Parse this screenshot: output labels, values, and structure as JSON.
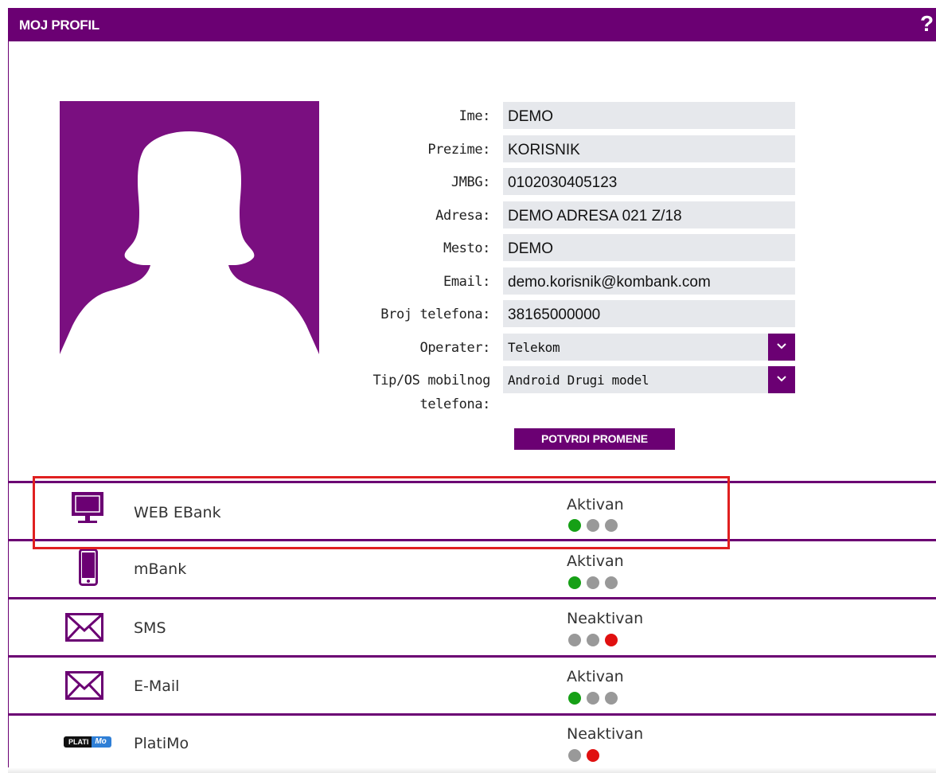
{
  "header": {
    "title": "MOJ PROFIL",
    "help": "?"
  },
  "profile": {
    "fields": [
      {
        "label": "Ime:",
        "value": "DEMO"
      },
      {
        "label": "Prezime:",
        "value": "KORISNIK"
      },
      {
        "label": "JMBG:",
        "value": "0102030405123"
      },
      {
        "label": "Adresa:",
        "value": "DEMO ADRESA 021 Z/18"
      },
      {
        "label": "Mesto:",
        "value": "DEMO"
      },
      {
        "label": "Email:",
        "value": "demo.korisnik@kombank.com"
      },
      {
        "label": "Broj telefona:",
        "value": "38165000000"
      }
    ],
    "operater": {
      "label": "Operater:",
      "value": "Telekom"
    },
    "tip_os": {
      "label_line1": "Tip/OS mobilnog",
      "label_line2": "telefona:",
      "value": "Android Drugi model"
    },
    "confirm_label": "POTVRDI PROMENE"
  },
  "services": [
    {
      "name": "WEB EBank",
      "status": "Aktivan",
      "icon": "monitor-icon",
      "dots": [
        "green",
        "grey",
        "grey"
      ]
    },
    {
      "name": "mBank",
      "status": "Aktivan",
      "icon": "mobile-phone-icon",
      "dots": [
        "green",
        "grey",
        "grey"
      ]
    },
    {
      "name": "SMS",
      "status": "Neaktivan",
      "icon": "envelope-icon",
      "dots": [
        "grey",
        "grey",
        "red"
      ]
    },
    {
      "name": "E-Mail",
      "status": "Aktivan",
      "icon": "envelope-icon",
      "dots": [
        "green",
        "grey",
        "grey"
      ]
    },
    {
      "name": "PlatiMo",
      "status": "Neaktivan",
      "icon": "platimo-logo-icon",
      "dots": [
        "grey",
        "red"
      ],
      "logo_text_1": "PLATI",
      "logo_text_2": "Mo"
    }
  ],
  "colors": {
    "brand_purple": "#6b0073",
    "avatar_bg": "#7a0f80",
    "field_bg": "#e6e8ec",
    "status_active": "#16a016",
    "status_inactive": "#e01010",
    "status_idle": "#999999",
    "highlight": "#e02020"
  }
}
